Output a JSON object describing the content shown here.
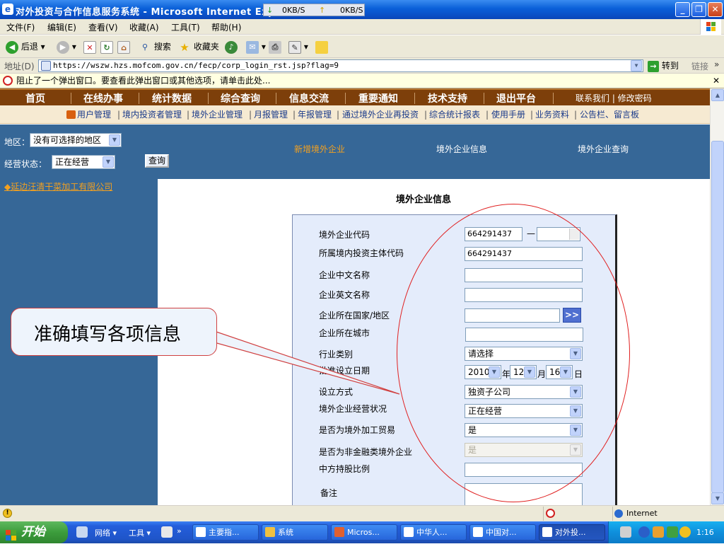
{
  "window": {
    "title": "对外投资与合作信息服务系统 - Microsoft Internet Explorer",
    "net_down": "0KB/S",
    "net_up": "0KB/S"
  },
  "menu": [
    "文件(F)",
    "编辑(E)",
    "查看(V)",
    "收藏(A)",
    "工具(T)",
    "帮助(H)"
  ],
  "toolbar": {
    "back": "后退",
    "search": "搜索",
    "favorites": "收藏夹"
  },
  "address": {
    "label": "地址(D)",
    "url": "https://wszw.hzs.mofcom.gov.cn/fecp/corp_login_rst.jsp?flag=9",
    "go": "转到",
    "links": "链接"
  },
  "popup_notice": "阻止了一个弹出窗口。要查看此弹出窗口或其他选项，请单击此处...",
  "nav_main": [
    "首页",
    "在线办事",
    "统计数据",
    "综合查询",
    "信息交流",
    "重要通知",
    "技术支持",
    "退出平台"
  ],
  "nav_right": "联系我们 | 修改密码",
  "nav_sub": [
    "用户管理",
    "境内投资者管理",
    "境外企业管理",
    "月报管理",
    "年报管理",
    "通过境外企业再投资",
    "综合统计报表",
    "使用手册",
    "业务资料",
    "公告栏、留言板"
  ],
  "filters": {
    "region_label": "地区：",
    "region_value": "没有可选择的地区",
    "status_label": "经营状态：",
    "status_value": "正在经营",
    "query_button": "查询"
  },
  "top_links": [
    "新增境外企业",
    "境外企业信息",
    "境外企业查询"
  ],
  "company_link": "◆延边汪清干菜加工有限公司",
  "form": {
    "title": "境外企业信息",
    "fields": [
      {
        "label": "境外企业代码",
        "value": "664291437"
      },
      {
        "label": "所属境内投资主体代码",
        "value": "664291437"
      },
      {
        "label": "企业中文名称",
        "value": ""
      },
      {
        "label": "企业英文名称",
        "value": ""
      },
      {
        "label": "企业所在国家/地区",
        "value": ""
      },
      {
        "label": "企业所在城市",
        "value": ""
      },
      {
        "label": "行业类别",
        "value": "请选择"
      },
      {
        "label": "批准设立日期",
        "value": ""
      },
      {
        "label": "设立方式",
        "value": "独资子公司"
      },
      {
        "label": "境外企业经营状况",
        "value": "正在经营"
      },
      {
        "label": "是否为境外加工贸易",
        "value": "是"
      },
      {
        "label": "是否为非金融类境外企业",
        "value": "是"
      },
      {
        "label": "中方持股比例",
        "value": ""
      },
      {
        "label": "备注",
        "value": ""
      }
    ],
    "code_separator": "—",
    "country_button": ">>",
    "date": {
      "year": "2010",
      "year_unit": "年",
      "month": "12",
      "month_unit": "月",
      "day": "16",
      "day_unit": "日"
    }
  },
  "callout": "准确填写各项信息",
  "status_bar": {
    "zone": "Internet"
  },
  "taskbar": {
    "start": "开始",
    "quick": [
      "网络",
      "工具"
    ],
    "items": [
      "主要指...",
      "系统",
      "Micros...",
      "中华人...",
      "中国对...",
      "对外投..."
    ],
    "clock": "1:16"
  },
  "colors": {
    "nav_brown": "#7d3f0a",
    "panel_blue": "#366797",
    "link_orange": "#f2a020",
    "annotation_red": "#e02020"
  }
}
